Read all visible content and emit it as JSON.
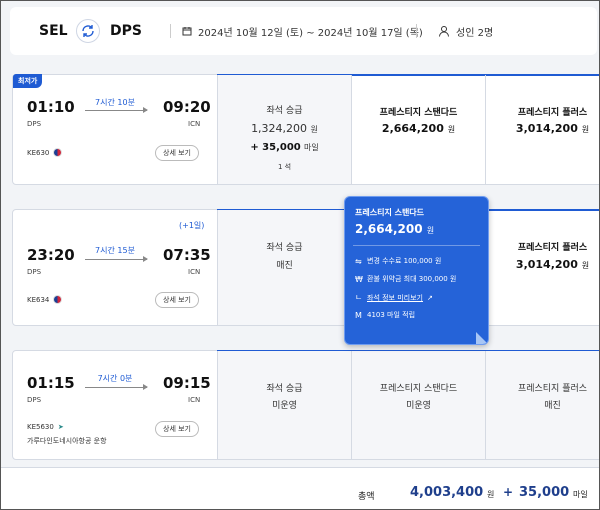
{
  "header": {
    "from": "SEL",
    "to": "DPS",
    "dates": "2024년 10월 12일 (토) ~ 2024년 10월 17일 (목)",
    "passengers": "성인 2명"
  },
  "colors": {
    "accent": "#1f5bd3",
    "popover": "#2563d8",
    "total": "#1f3f8c"
  },
  "flights": [
    {
      "badge": "최저가",
      "dep_time": "01:10",
      "dep_ap": "DPS",
      "duration": "7시간 10분",
      "arr_time": "09:20",
      "arr_ap": "ICN",
      "flight_no": "KE630",
      "detail": "상세 보기",
      "fares": [
        {
          "class": "좌석 승급",
          "price": "1,324,200",
          "won": "원",
          "miles": "+ 35,000",
          "miles_unit": "마일",
          "seats": "1 석"
        },
        {
          "class": "프레스티지 스탠다드",
          "price": "2,664,200",
          "won": "원"
        },
        {
          "class": "프레스티지 플러스",
          "price": "3,014,200",
          "won": "원"
        }
      ]
    },
    {
      "dep_time": "23:20",
      "dep_ap": "DPS",
      "duration": "7시간 15분",
      "next_day": "(+1일)",
      "arr_time": "07:35",
      "arr_ap": "ICN",
      "flight_no": "KE634",
      "detail": "상세 보기",
      "fares": [
        {
          "class": "좌석 승급",
          "status": "매진"
        },
        {
          "class": "프레스티지 플러스",
          "price": "3,014,200",
          "won": "원"
        }
      ]
    },
    {
      "dep_time": "01:15",
      "dep_ap": "DPS",
      "duration": "7시간 0분",
      "arr_time": "09:15",
      "arr_ap": "ICN",
      "flight_no": "KE5630",
      "operator": "가루다인도네시아항공 운항",
      "detail": "상세 보기",
      "fares": [
        {
          "class": "좌석 승급",
          "status": "미운영"
        },
        {
          "class": "프레스티지 스탠다드",
          "status": "미운영"
        },
        {
          "class": "프레스티지 플러스",
          "status": "매진"
        }
      ]
    }
  ],
  "popover": {
    "title": "프레스티지 스탠다드",
    "price": "2,664,200",
    "won": "원",
    "change": "변경  수수료 100,000 원",
    "refund": "환불  위약금 최대 300,000 원",
    "seat_info": "좌석 정보 미리보기",
    "miles": "4103 마일 적립"
  },
  "footer": {
    "label": "총액",
    "amount": "4,003,400",
    "won": "원",
    "plus": "+",
    "miles": "35,000",
    "miles_unit": "마일"
  }
}
